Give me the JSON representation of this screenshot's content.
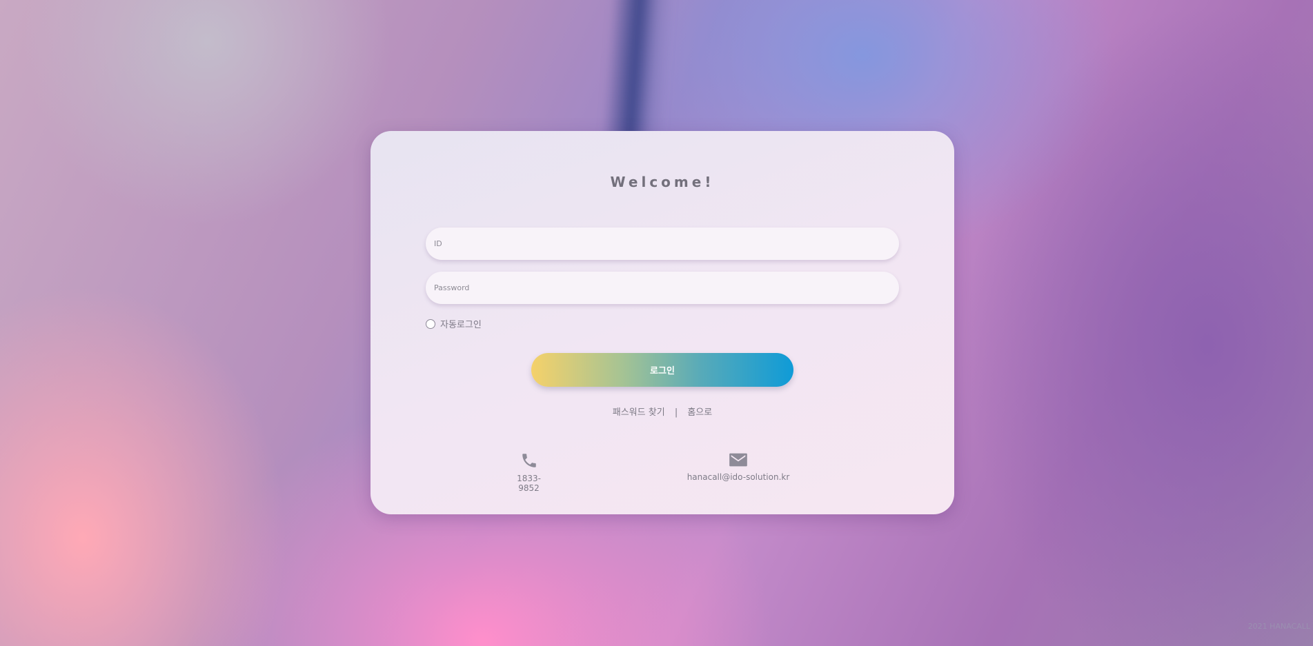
{
  "login": {
    "title": "Welcome!",
    "id_placeholder": "ID",
    "password_placeholder": "Password",
    "remember_label": "자동로그인",
    "login_button_label": "로그인",
    "find_password_label": "패스워드 찾기",
    "separator": "|",
    "home_label": "홈으로"
  },
  "contact": {
    "phone": "1833-9852",
    "phone_icon": "phone-icon",
    "email": "hanacall@ido-solution.kr",
    "email_icon": "mail-icon"
  },
  "footer": {
    "copyright": "2021 HANACALL"
  },
  "colors": {
    "button_gradient_start": "#f5d16a",
    "button_gradient_end": "#0f9bd7",
    "text_muted": "#7b7884"
  }
}
